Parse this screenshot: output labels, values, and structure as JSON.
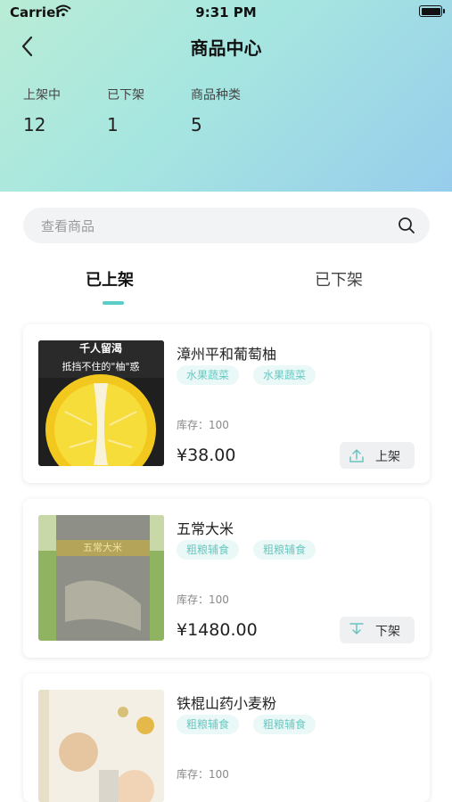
{
  "status_bar": {
    "carrier": "Carrier",
    "time": "9:31 PM"
  },
  "header": {
    "title": "商品中心"
  },
  "stats": [
    {
      "label": "上架中",
      "value": "12"
    },
    {
      "label": "已下架",
      "value": "1"
    },
    {
      "label": "商品种类",
      "value": "5"
    }
  ],
  "search": {
    "placeholder": "查看商品"
  },
  "tabs": [
    {
      "label": "已上架",
      "active": true
    },
    {
      "label": "已下架",
      "active": false
    }
  ],
  "products": [
    {
      "name": "漳州平和葡萄柚",
      "tags": [
        "水果蔬菜",
        "水果蔬菜"
      ],
      "stock": "库存：100",
      "price": "¥38.00",
      "action": "上架",
      "action_icon": "upload-icon",
      "image_caption_1": "千人留渴",
      "image_caption_2": "抵挡不住的\"柚\"惑"
    },
    {
      "name": "五常大米",
      "tags": [
        "粗粮辅食",
        "粗粮辅食"
      ],
      "stock": "库存：100",
      "price": "¥1480.00",
      "action": "下架",
      "action_icon": "download-icon",
      "image_caption_1": "五常大米"
    },
    {
      "name": "铁棍山药小麦粉",
      "tags": [
        "粗粮辅食",
        "粗粮辅食"
      ],
      "stock": "库存：100",
      "price": "",
      "action": "",
      "action_icon": ""
    }
  ],
  "colors": {
    "accent": "#5ccdc9",
    "tag_bg": "#eaf8f7",
    "tag_text": "#69c9c3",
    "header_start": "#b9ecd6",
    "header_end": "#97cdec"
  }
}
